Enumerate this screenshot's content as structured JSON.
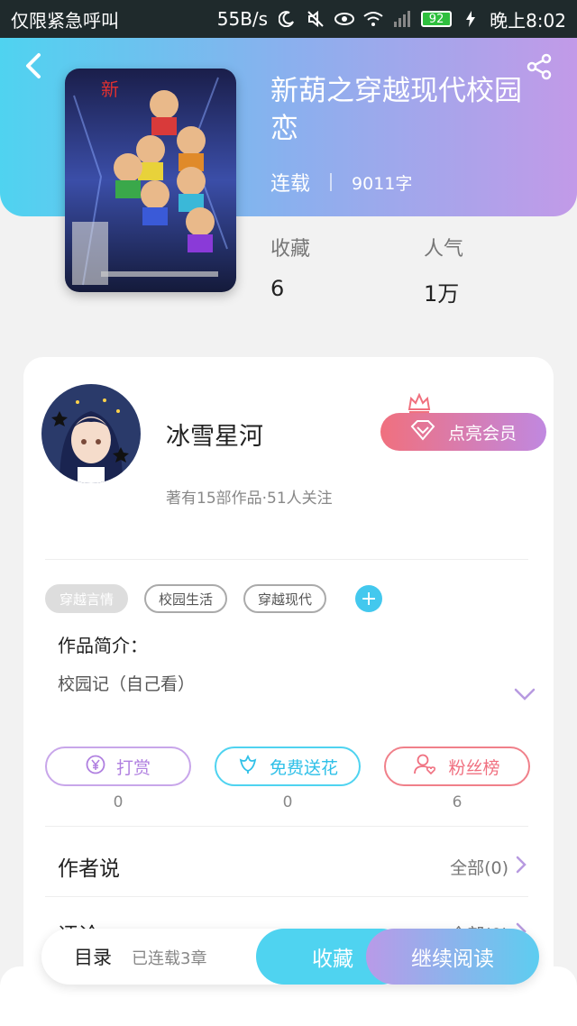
{
  "status_bar": {
    "carrier": "仅限紧急呼叫",
    "speed": "55B/s",
    "battery": "92",
    "time": "晚上8:02"
  },
  "book": {
    "title": "新葫之穿越现代校园恋",
    "status": "连载",
    "words": "9011字",
    "stats": {
      "favorites_label": "收藏",
      "favorites_value": "6",
      "popularity_label": "人气",
      "popularity_value": "1万"
    }
  },
  "author": {
    "name": "冰雪星河",
    "stats": "著有15部作品·51人关注",
    "vip_label": "点亮会员"
  },
  "tags": [
    "穿越言情",
    "校园生活",
    "穿越现代"
  ],
  "intro": {
    "title": "作品简介：",
    "text": "校园记（自己看）"
  },
  "actions": [
    {
      "label": "打赏",
      "count": "0",
      "icon": "yen-icon"
    },
    {
      "label": "免费送花",
      "count": "0",
      "icon": "flower-icon"
    },
    {
      "label": "粉丝榜",
      "count": "6",
      "icon": "fan-icon"
    }
  ],
  "sections": {
    "author_says": {
      "title": "作者说",
      "more": "全部(0)"
    },
    "comments": {
      "title": "评论",
      "more": "全部(0)"
    }
  },
  "bottom_bar": {
    "toc": "目录",
    "chapters": "已连载3章",
    "favorite": "收藏",
    "continue": "继续阅读"
  },
  "colors": {
    "accent_cyan": "#4fd3f0",
    "accent_purple": "#c29ae8",
    "accent_red": "#f0707e"
  }
}
